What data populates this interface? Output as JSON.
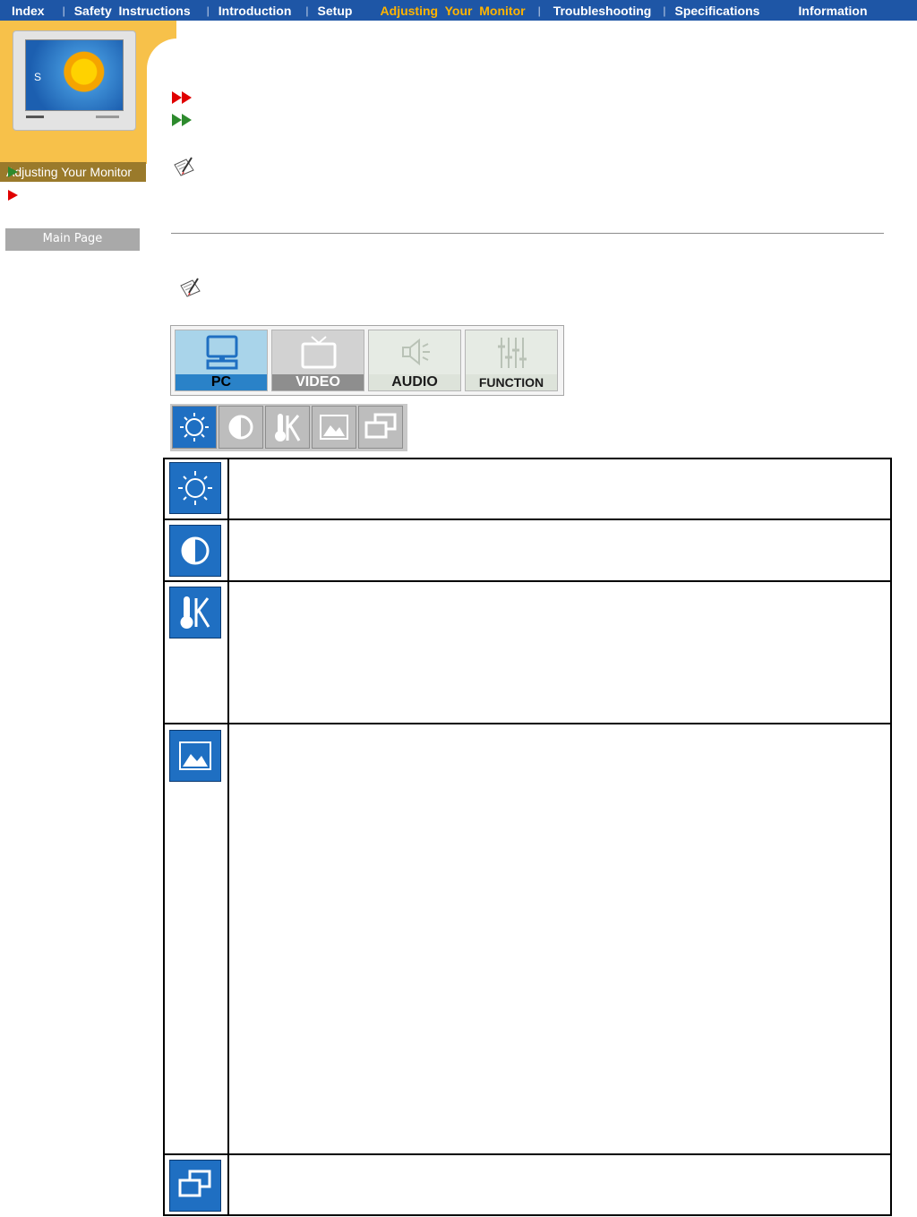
{
  "nav": {
    "items": [
      {
        "label": "Index",
        "active": false
      },
      {
        "label": "Safety  Instructions",
        "active": false
      },
      {
        "label": "Introduction",
        "active": false
      },
      {
        "label": "Setup",
        "active": false
      },
      {
        "label": "Adjusting  Your  Monitor",
        "active": true
      },
      {
        "label": "Troubleshooting",
        "active": false
      },
      {
        "label": "Specifications",
        "active": false
      },
      {
        "label": "Information",
        "active": false
      }
    ],
    "separator": "|",
    "colors": {
      "bar": "#1e56a6",
      "text": "#ffffff",
      "active": "#ffb400"
    }
  },
  "sidebar": {
    "monitor_letter": "S",
    "section_label": "Adjusting Your Monitor",
    "main_page_label": "Main Page"
  },
  "categories": [
    {
      "label": "PC",
      "selected": true,
      "icon": "pc-icon"
    },
    {
      "label": "VIDEO",
      "selected": false,
      "icon": "tv-icon"
    },
    {
      "label": "AUDIO",
      "selected": false,
      "icon": "speaker-icon"
    },
    {
      "label": "FUNCTION",
      "selected": false,
      "icon": "sliders-icon"
    }
  ],
  "subtabs": [
    {
      "icon": "brightness-icon",
      "active": true
    },
    {
      "icon": "contrast-icon",
      "active": false
    },
    {
      "icon": "color-temperature-icon",
      "active": false
    },
    {
      "icon": "image-icon",
      "active": false
    },
    {
      "icon": "windows-icon",
      "active": false
    }
  ],
  "table_rows": [
    {
      "icon": "brightness-icon",
      "text": ""
    },
    {
      "icon": "contrast-icon",
      "text": ""
    },
    {
      "icon": "color-temperature-icon",
      "text": ""
    },
    {
      "icon": "image-icon",
      "text": ""
    },
    {
      "icon": "windows-icon",
      "text": ""
    }
  ]
}
